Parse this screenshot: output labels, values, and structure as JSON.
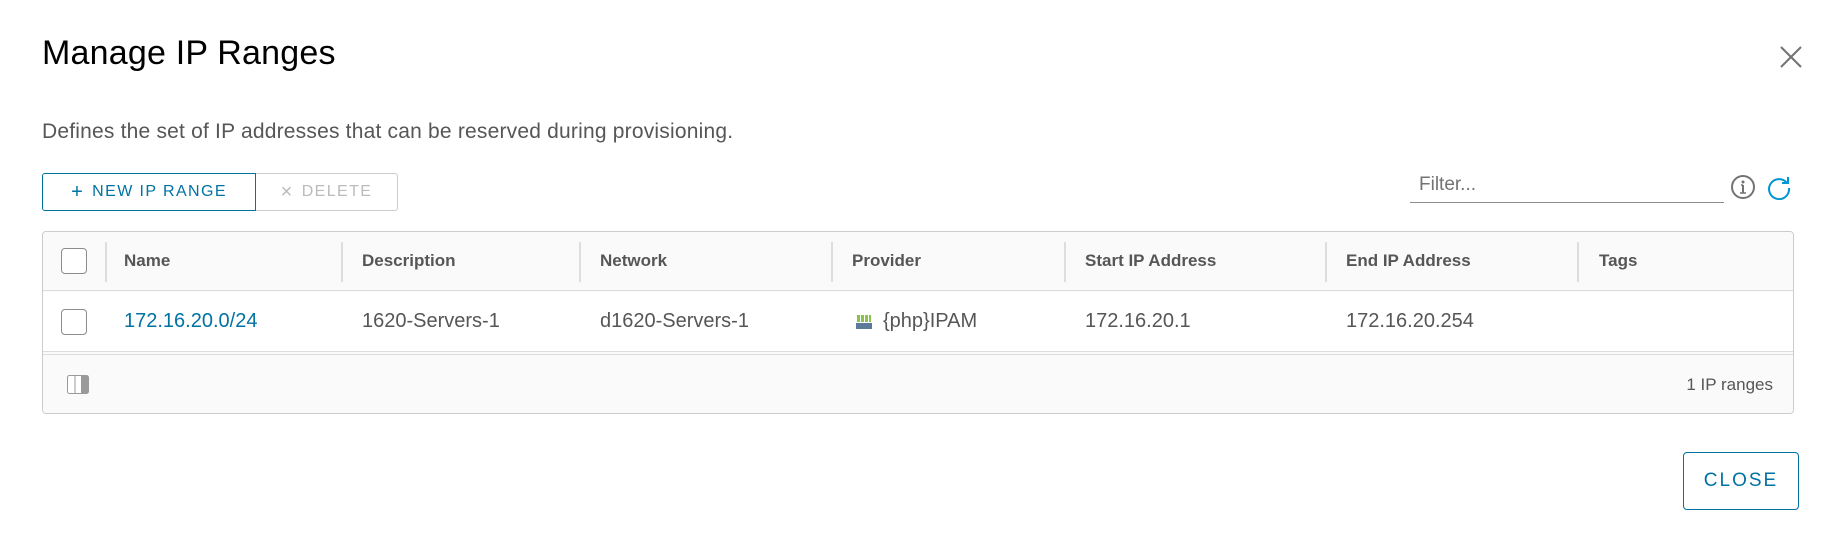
{
  "modal": {
    "title": "Manage IP Ranges",
    "description": "Defines the set of IP addresses that can be reserved during provisioning.",
    "close_icon": "close-icon"
  },
  "toolbar": {
    "new_label": "NEW IP RANGE",
    "new_icon": "+",
    "delete_label": "DELETE",
    "delete_icon": "×",
    "filter_placeholder": "Filter...",
    "filter_value": ""
  },
  "grid": {
    "columns": [
      "Name",
      "Description",
      "Network",
      "Provider",
      "Start IP Address",
      "End IP Address",
      "Tags"
    ],
    "rows": [
      {
        "name": "172.16.20.0/24",
        "description": "1620-Servers-1",
        "network": "d1620-Servers-1",
        "provider": "{php}IPAM",
        "start_ip": "172.16.20.1",
        "end_ip": "172.16.20.254",
        "tags": ""
      }
    ],
    "footer_count": "1 IP ranges"
  },
  "footer": {
    "close_label": "CLOSE"
  },
  "colors": {
    "accent": "#0072a3",
    "refresh": "#0095d3",
    "text": "#565656",
    "border": "#cccccc",
    "disabled": "#bbbbbb"
  }
}
